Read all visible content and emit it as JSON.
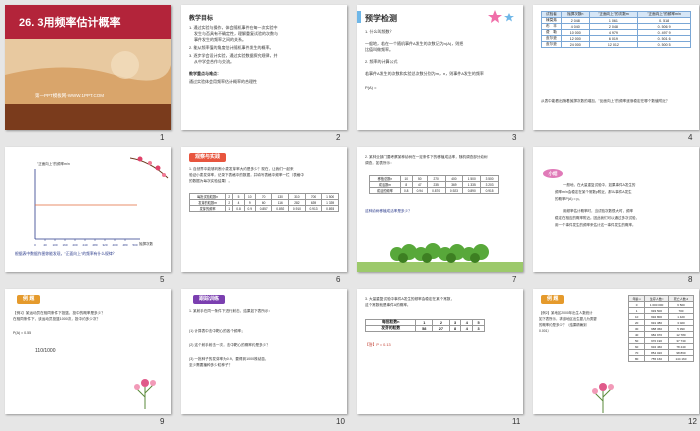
{
  "slides": [
    {
      "num": "1",
      "title": "26. 3用频率估计概率",
      "footer": "第一PPT模板网-WWW.1PPT.COM"
    },
    {
      "num": "2",
      "heading": "教学目标",
      "lines": [
        "1. 通过实验与操作，体会随机事件在每一次实验中",
        "发生与否具有不确定性，理解重复试验的次数与",
        "事件发生的频率之间的关系。",
        "2. 能从频率值的角度估计随机事件发生的概率。",
        "3. 逐步学会设计实验，通过实验数据探究规律，并",
        "从中学会合作与交流。"
      ],
      "key_heading": "教学重点与难点：",
      "key_line": "通过实验体会用频率估计概率的合理性"
    },
    {
      "num": "3",
      "heading": "预学检测",
      "lines": [
        "1. 什么叫频数？",
        "一般地，若在一个随机事件A发生的次数记为n(A)，则把",
        "比值叫做频率。",
        "2. 频率的计算公式",
        "若事件A发生的次数和实验总次数分别为m，n，则事件A发生的频率",
        "P(A) ="
      ]
    },
    {
      "num": "4",
      "header": [
        "试验者",
        "抛掷次数n",
        "\"正面向上\"的次数m",
        "\"正面向上\"的频率m/n"
      ],
      "rows": [
        [
          "棣莫弗",
          "2 048",
          "1 061",
          "0. 518"
        ],
        [
          "布　丰",
          "4 040",
          "2 048",
          "0. 506 9"
        ],
        [
          "费　勒",
          "10 000",
          "4 979",
          "0. 497 9"
        ],
        [
          "皮尔逊",
          "12 000",
          "6 019",
          "0. 501 6"
        ],
        [
          "皮尔逊",
          "24 000",
          "12 012",
          "0. 500 5"
        ]
      ],
      "note": "从表中能看出随着抛掷次数的增加，\"反面向上\"的频率逐渐稳定在哪个数值附近？"
    },
    {
      "num": "5",
      "chart_ylabel": "\"正面向上\"的频率m/n",
      "chart_xlabel": "抛掷次数",
      "chart_ticks": [
        "0",
        "40",
        "100",
        "160",
        "200",
        "240",
        "280",
        "320",
        "400",
        "480",
        "500"
      ],
      "caption": "根据表中数据作图你能发现，\"正面向上\"的频率有什么规律？"
    },
    {
      "num": "6",
      "ribbon": "观察与实践",
      "lines": [
        "1. 自然界中能够判断小麦发芽率大约是多少？现在，让我们一起来",
        "验证小麦发芽率，记录下表格中的数据，并填写表格中频率一栏（表格中",
        "的数据为每次实验结果）。"
      ],
      "table": [
        [
          "每批试验粒数n",
          "2",
          "5",
          "10",
          "70",
          "130",
          "310",
          "700",
          "1 500"
        ],
        [
          "发芽的粒数m",
          "2",
          "4",
          "9",
          "60",
          "116",
          "282",
          "639",
          "1 339"
        ],
        [
          "发芽的频率",
          "1",
          "0.8",
          "0.9",
          "0.857",
          "0.892",
          "0.910",
          "0.913",
          "0.893"
        ]
      ]
    },
    {
      "num": "7",
      "lines": [
        "2. 某林业部门要考察某种幼树在一定条件下的移植成活率，随机调查部分幼树",
        "调查，如表所示："
      ],
      "table": [
        [
          "移植总数n",
          "10",
          "50",
          "270",
          "400",
          "1 500",
          "3 500"
        ],
        [
          "成活数m",
          "8",
          "47",
          "235",
          "369",
          "1 335",
          "3 203"
        ],
        [
          "成活的频率",
          "0.8",
          "0.94",
          "0.870",
          "0.923",
          "0.890",
          "0.915"
        ]
      ],
      "question": "这种幼树移植成活率是多少？"
    },
    {
      "num": "8",
      "badge": "小结",
      "lines": [
        "一般地，在大量重复试验中，如果事件A发生的",
        "频率m/n会稳定在某个常数p附近，那么事件A发生",
        "的概率P(A) = p。",
        "用频率估计概率时，当试验次数很大时，频率",
        "稳定在相应的概率附近。因此我们可以通过多次试验，",
        "用一个事件发生的频率来估计这一事件发生的概率。"
      ]
    },
    {
      "num": "9",
      "ribbon": "例 题",
      "lines": [
        "【例1】某运动员在相同条件下投篮，投中的概率是多少？",
        "在相同条件下，该运动员投篮1000次，投中约多少次？",
        "P(A) ≈ 0.55"
      ],
      "fraction": "110/1000"
    },
    {
      "num": "10",
      "ribbon": "跟踪训练",
      "lines": [
        "1. 某射手在同一条件下进行射击，结果如下表所示：",
        "(1) 计算表中击中靶心的各个频率；",
        "(2) 这个射手射击一次，击中靶心的概率约是多少？",
        "(3) 一批种子的发芽率为0.9，要得到1000株幼苗，",
        "至少需要播种多少粒种子？"
      ]
    },
    {
      "num": "11",
      "lines": [
        "3. 大量重复试验中事件A发生的频率会稳定在某个常数，",
        "这个常数就是事件A的概率。"
      ],
      "table": [
        [
          "每批粒数n",
          "1",
          "2",
          "3",
          "4",
          "5"
        ],
        [
          "发芽的粒数",
          "58",
          "27",
          "8",
          "4",
          "3"
        ]
      ],
      "answer": "【答】P = 0.13"
    },
    {
      "num": "12",
      "ribbon": "例 题",
      "lines": [
        "【例2】某地区2000年出生人数统计",
        "如下表所示，求该地区出生婴儿为男婴",
        "的概率约是多少？（结果精确到",
        "0.001）"
      ],
      "header": [
        "年龄 x",
        "生存人数 l",
        "死亡人数 d"
      ],
      "rows": [
        [
          "0",
          "1 000 000",
          "6 500"
        ],
        [
          "1",
          "993 500",
          "700"
        ],
        [
          "10",
          "992 800",
          "1 420"
        ],
        [
          "20",
          "991 380",
          "3 020"
        ],
        [
          "30",
          "988 360",
          "5 390"
        ],
        [
          "40",
          "982 970",
          "12 780"
        ],
        [
          "50",
          "970 190",
          "37 730"
        ],
        [
          "60",
          "932 460",
          "78 440"
        ],
        [
          "70",
          "854 020",
          "98 860"
        ],
        [
          "80",
          "755 160",
          "144 160"
        ]
      ]
    }
  ]
}
